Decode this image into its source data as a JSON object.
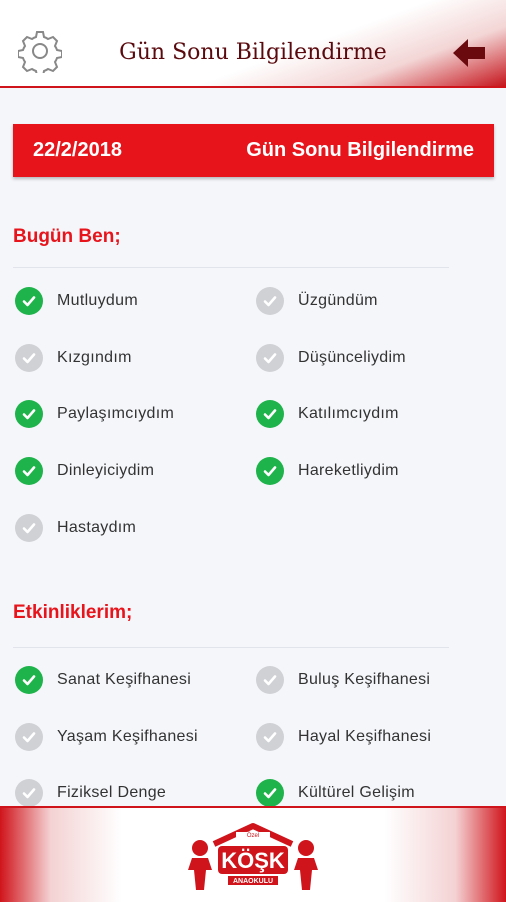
{
  "header": {
    "title": "Gün Sonu Bilgilendirme",
    "settings_icon": "gear-icon",
    "back_icon": "arrow-left-icon"
  },
  "banner": {
    "date": "22/2/2018",
    "title": "Gün Sonu Bilgilendirme"
  },
  "section_mood": {
    "title": "Bugün Ben;",
    "items": [
      {
        "label": "Mutluydum",
        "checked": true
      },
      {
        "label": "Üzgündüm",
        "checked": false
      },
      {
        "label": "Kızgındım",
        "checked": false
      },
      {
        "label": "Düşünceliydim",
        "checked": false
      },
      {
        "label": "Paylaşımcıydım",
        "checked": true
      },
      {
        "label": "Katılımcıydım",
        "checked": true
      },
      {
        "label": "Dinleyiciydim",
        "checked": true
      },
      {
        "label": "Hareketliydim",
        "checked": true
      },
      {
        "label": "Hastaydım",
        "checked": false
      }
    ]
  },
  "section_activities": {
    "title": "Etkinliklerim;",
    "items": [
      {
        "label": "Sanat Keşifhanesi",
        "checked": true
      },
      {
        "label": "Buluş Keşifhanesi",
        "checked": false
      },
      {
        "label": "Yaşam Keşifhanesi",
        "checked": false
      },
      {
        "label": "Hayal Keşifhanesi",
        "checked": false
      },
      {
        "label": "Fiziksel Denge",
        "checked": false
      },
      {
        "label": "Kültürel Gelişim",
        "checked": true
      }
    ]
  },
  "footer": {
    "logo_text": "KÖŞK",
    "logo_top": "Özel",
    "logo_bottom": "ANAOKULU"
  },
  "colors": {
    "accent": "#e8141c",
    "check_on": "#1fb34b",
    "check_off": "#cfd1d5"
  }
}
